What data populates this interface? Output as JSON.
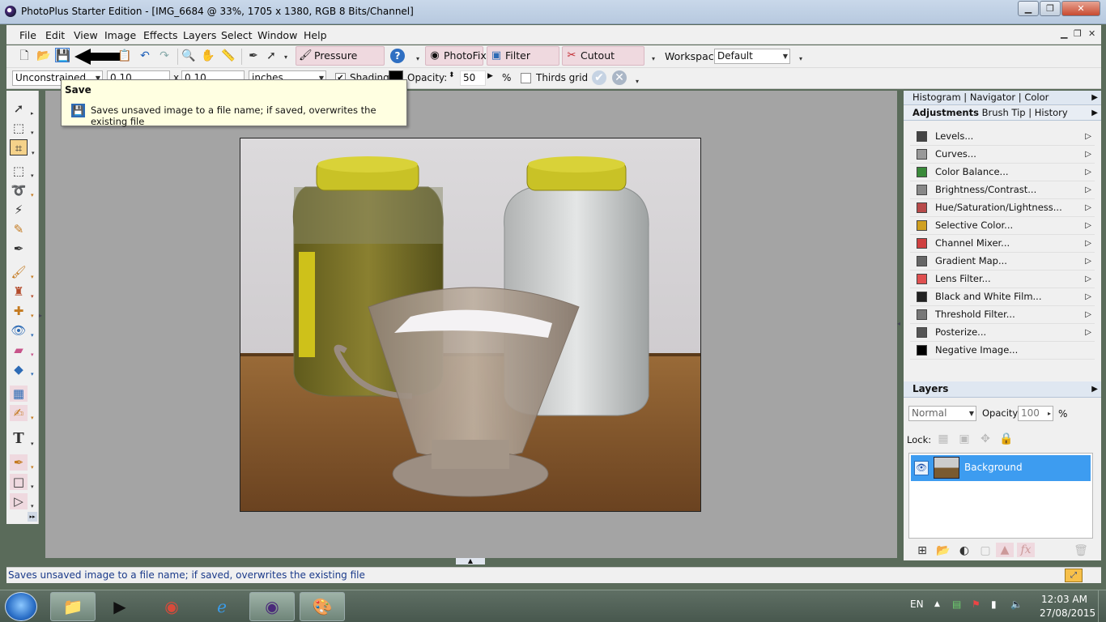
{
  "window": {
    "title": "PhotoPlus Starter Edition - [IMG_6684 @ 33%, 1705 x 1380, RGB 8 Bits/Channel]",
    "min_label": "▁",
    "max_label": "❐",
    "close_label": "✕"
  },
  "menu": {
    "items": [
      "File",
      "Edit",
      "View",
      "Image",
      "Effects",
      "Layers",
      "Select",
      "Window",
      "Help"
    ],
    "doc_controls": [
      "▁",
      "❐",
      "✕"
    ]
  },
  "toolbar": {
    "pressure_studio": "Pressure Studio",
    "photofix": "PhotoFix",
    "filter_gallery": "Filter Gallery",
    "cutout_studio": "Cutout Studio",
    "workspace_label": "Workspace",
    "workspace_value": "Default"
  },
  "context_bar": {
    "constraint": "Unconstrained",
    "width": "0.10",
    "times": "x",
    "height": "0.10",
    "units": "inches",
    "shading_label": "Shading",
    "opacity_label": "Opacity:",
    "opacity_value": "50",
    "percent": "%",
    "thirds_grid_label": "Thirds grid"
  },
  "tooltip": {
    "title": "Save",
    "text": "Saves unsaved image to a file name; if saved, overwrites the existing file"
  },
  "right_panel": {
    "top_tabs": [
      "Histogram",
      "Navigator",
      "Color"
    ],
    "adj_tabs": [
      "Adjustments",
      "Brush Tip",
      "History"
    ],
    "adjustments": [
      {
        "label": "Levels...",
        "icon": "levels-icon"
      },
      {
        "label": "Curves...",
        "icon": "curves-icon"
      },
      {
        "label": "Color Balance...",
        "icon": "color-balance-icon"
      },
      {
        "label": "Brightness/Contrast...",
        "icon": "brightness-icon"
      },
      {
        "label": "Hue/Saturation/Lightness...",
        "icon": "hue-icon"
      },
      {
        "label": "Selective Color...",
        "icon": "selective-color-icon"
      },
      {
        "label": "Channel Mixer...",
        "icon": "channel-mixer-icon"
      },
      {
        "label": "Gradient Map...",
        "icon": "gradient-map-icon"
      },
      {
        "label": "Lens Filter...",
        "icon": "lens-filter-icon"
      },
      {
        "label": "Black and White Film...",
        "icon": "bw-film-icon"
      },
      {
        "label": "Threshold Filter...",
        "icon": "threshold-icon"
      },
      {
        "label": "Posterize...",
        "icon": "posterize-icon"
      },
      {
        "label": "Negative Image...",
        "icon": "negative-icon"
      }
    ],
    "layers": {
      "title": "Layers",
      "blend_mode": "Normal",
      "opacity_label": "Opacity:",
      "opacity_value": "100",
      "percent": "%",
      "lock_label": "Lock:",
      "layer_name": "Background"
    }
  },
  "status": {
    "text": "Saves unsaved image to a file name; if saved, overwrites the existing file"
  },
  "taskbar": {
    "lang": "EN",
    "time": "12:03 AM",
    "date": "27/08/2015"
  }
}
